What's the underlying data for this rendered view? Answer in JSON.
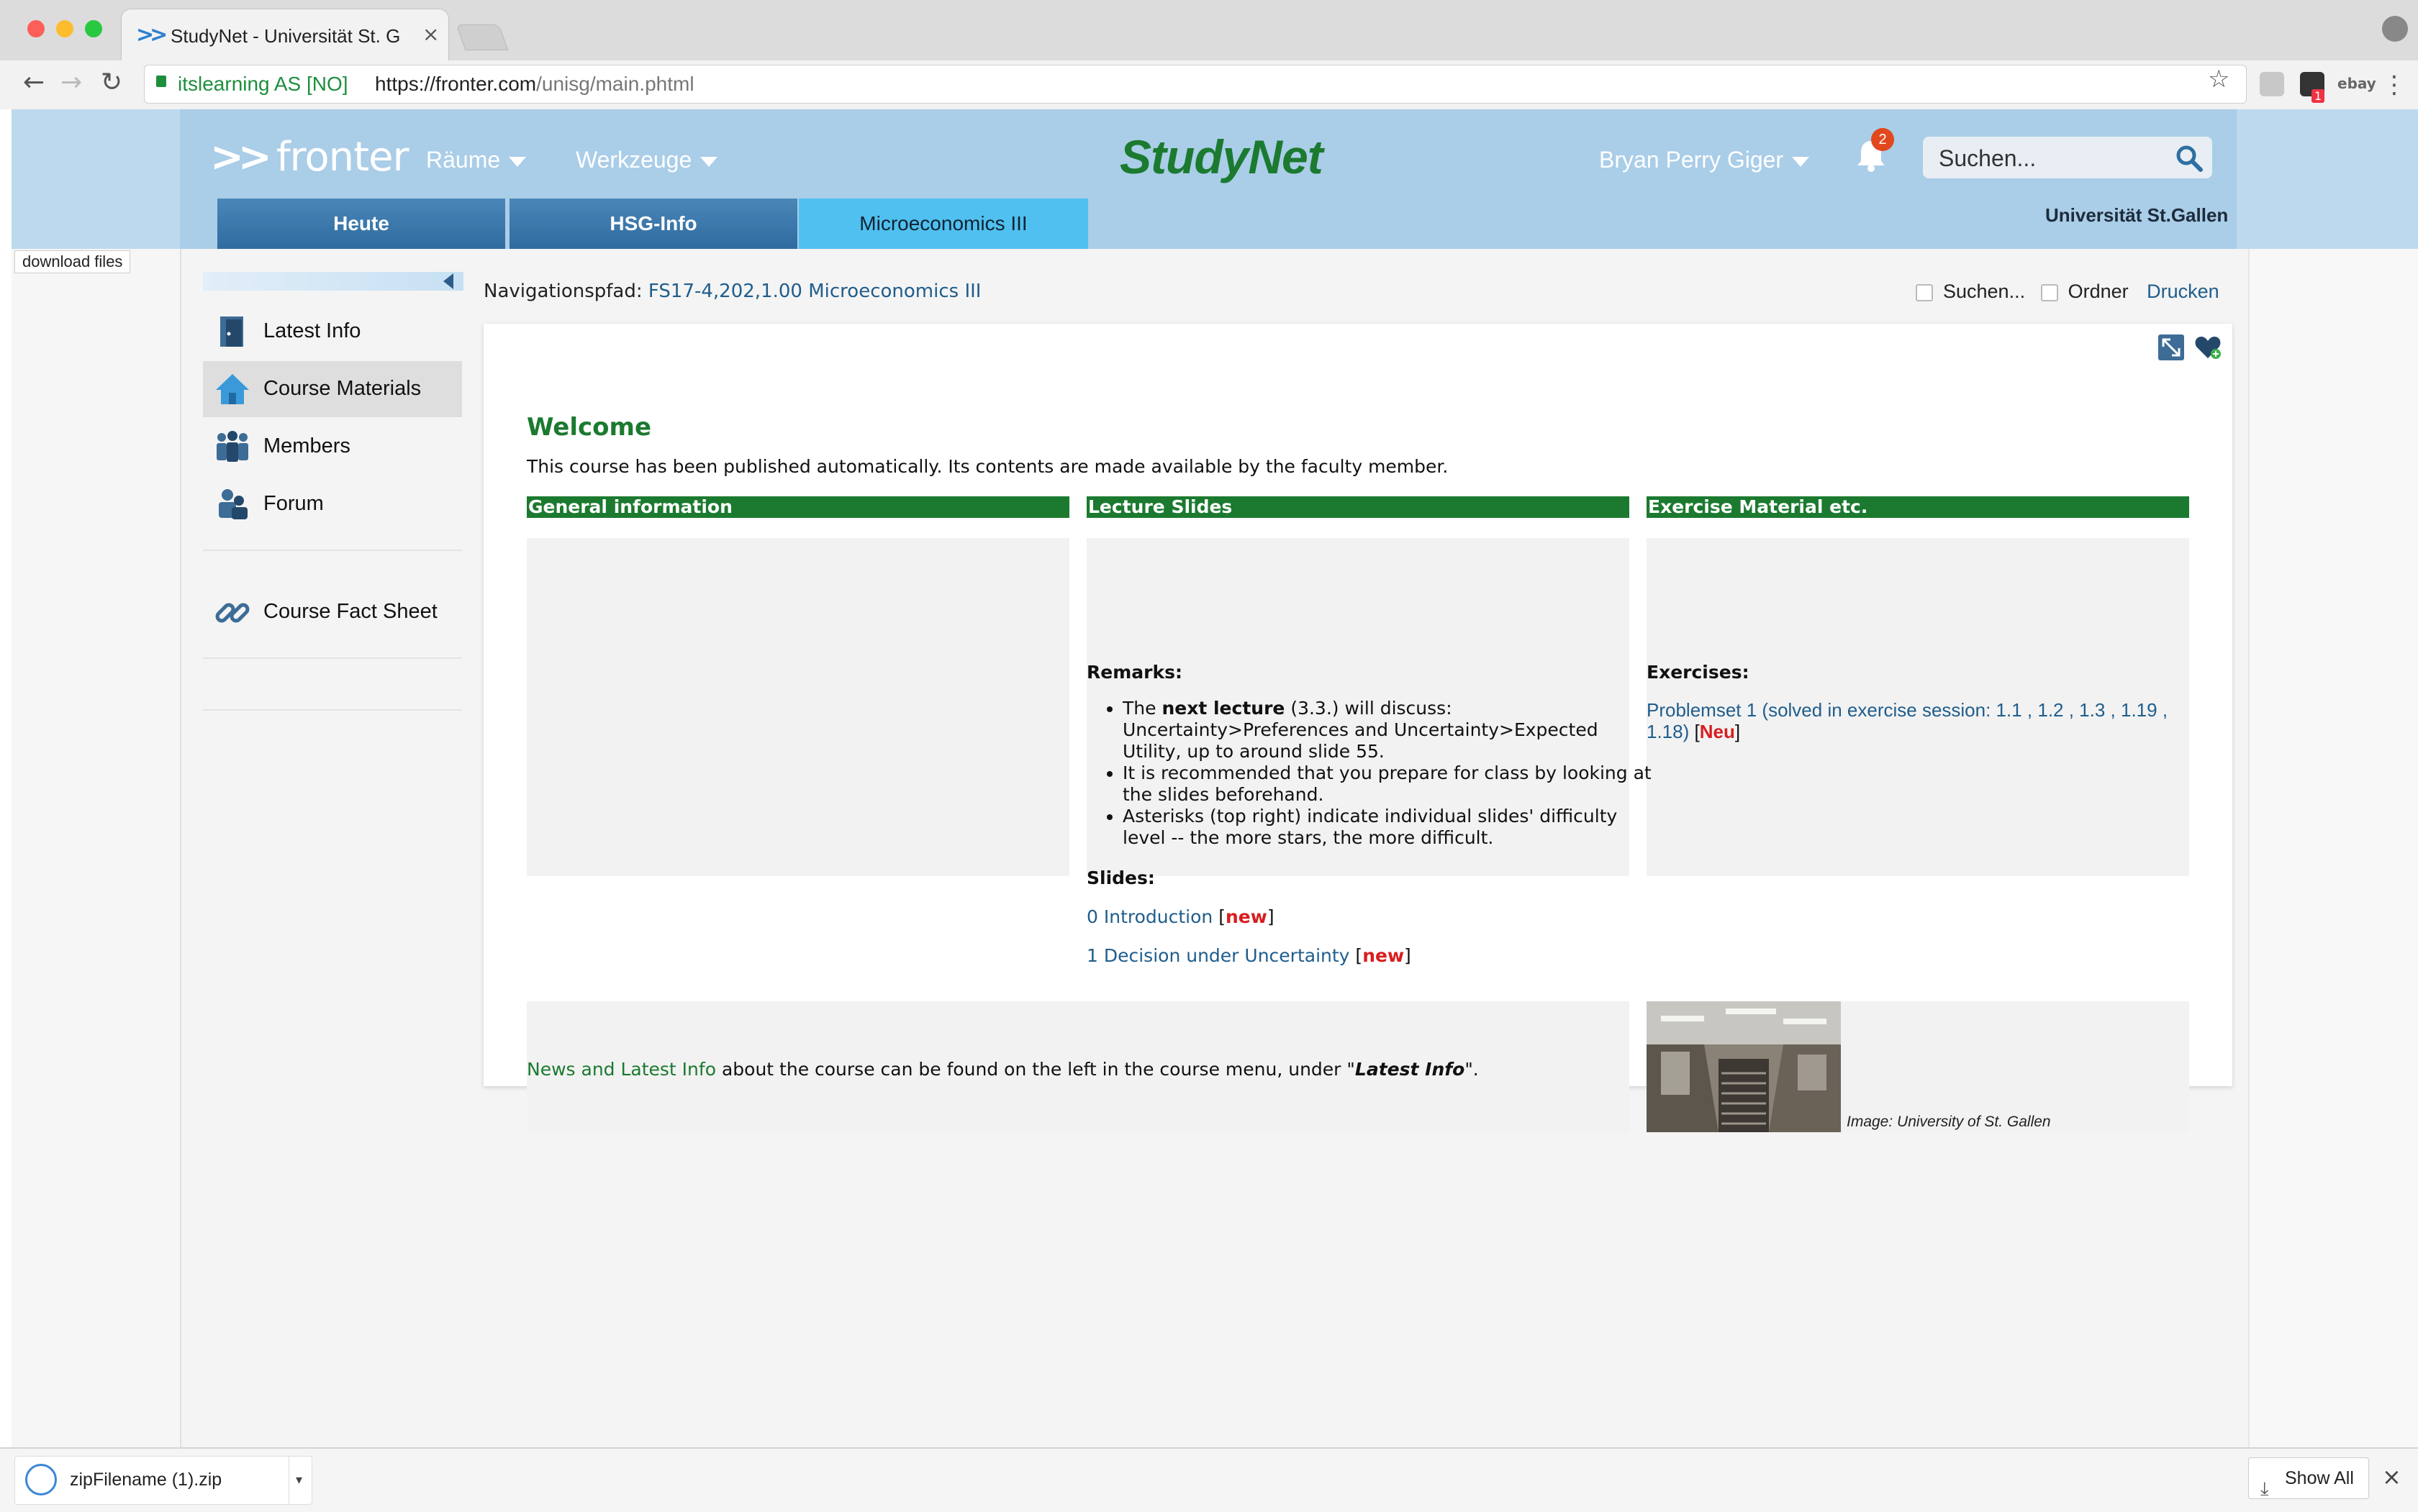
{
  "browser": {
    "tab_title": "StudyNet - Universität St. Gallen",
    "tab_favicon": ">>",
    "tab_close": "×",
    "secure_label": "itslearning AS [NO]",
    "url_host": "https://fronter.com",
    "url_path": "/unisg/main.phtml",
    "nav_back": "←",
    "nav_forward": "→",
    "nav_reload": "↻",
    "star": "☆",
    "ext_badge": "1",
    "ext_ebay": "ebay",
    "menu": "⋮"
  },
  "header": {
    "logo_arrows": ">>",
    "logo_text": "fronter",
    "menu_raeume": "Räume",
    "menu_werkzeuge": "Werkzeuge",
    "studynet": "StudyNet",
    "user_name": "Bryan Perry Giger",
    "notification_count": "2",
    "search_placeholder": "Suchen...",
    "university": "Universität St.Gallen",
    "brand_color": "#1b7a2f",
    "header_color": "#aacde8"
  },
  "tabs": [
    {
      "label": "Heute"
    },
    {
      "label": "HSG-Info"
    },
    {
      "label": "Microeconomics III"
    }
  ],
  "download_files_label": "download files",
  "sidebar": {
    "items": [
      {
        "label": "Latest Info",
        "icon": "door-icon"
      },
      {
        "label": "Course Materials",
        "icon": "home-icon"
      },
      {
        "label": "Members",
        "icon": "people-icon"
      },
      {
        "label": "Forum",
        "icon": "forum-icon"
      },
      {
        "label": "Course Fact Sheet",
        "icon": "link-icon"
      }
    ]
  },
  "breadcrumb": {
    "prefix": "Navigationspfad:",
    "link": "FS17-4,202,1.00 Microeconomics III"
  },
  "actions": {
    "search_label": "Suchen...",
    "folder_label": "Ordner",
    "print_label": "Drucken"
  },
  "content": {
    "title": "Welcome",
    "intro": "This course has been published automatically. Its contents are made available by the faculty member.",
    "col1_head": "General information",
    "col2_head": "Lecture Slides",
    "col3_head": "Exercise Material etc.",
    "remarks_heading": "Remarks:",
    "remark_1_pre": "The ",
    "remark_1_bold": "next lecture",
    "remark_1_post": " (3.3.) will discuss: Uncertainty>Preferences and Uncertainty>Expected Utility, up to around slide 55.",
    "remark_2": "It is recommended that you prepare for class by looking at the slides beforehand.",
    "remark_3": "Asterisks (top right) indicate individual slides' difficulty level -- the more stars, the more difficult.",
    "slides_heading": "Slides:",
    "slide_0": "0 Introduction",
    "slide_1": "1 Decision under Uncertainty",
    "new_tag": "new",
    "bracket_open": "[",
    "bracket_close": "]",
    "exercises_heading": "Exercises:",
    "problemset_link": "Problemset 1",
    "problemset_solved": " (solved in exercise session: 1.1 , 1.2 , 1.3 , 1.19 , 1.18)",
    "neu_tag": "Neu",
    "news_link": "News and Latest Info",
    "news_mid": " about the course can be found on the left in the course menu, under \"",
    "news_italic": "Latest Info",
    "news_end": "\".",
    "image_caption": "Image: University of St. Gallen"
  },
  "download_shelf": {
    "filename": "zipFilename (1).zip",
    "caret": "▾",
    "show_all": "Show All",
    "show_all_icon": "⤓",
    "close": "×"
  }
}
